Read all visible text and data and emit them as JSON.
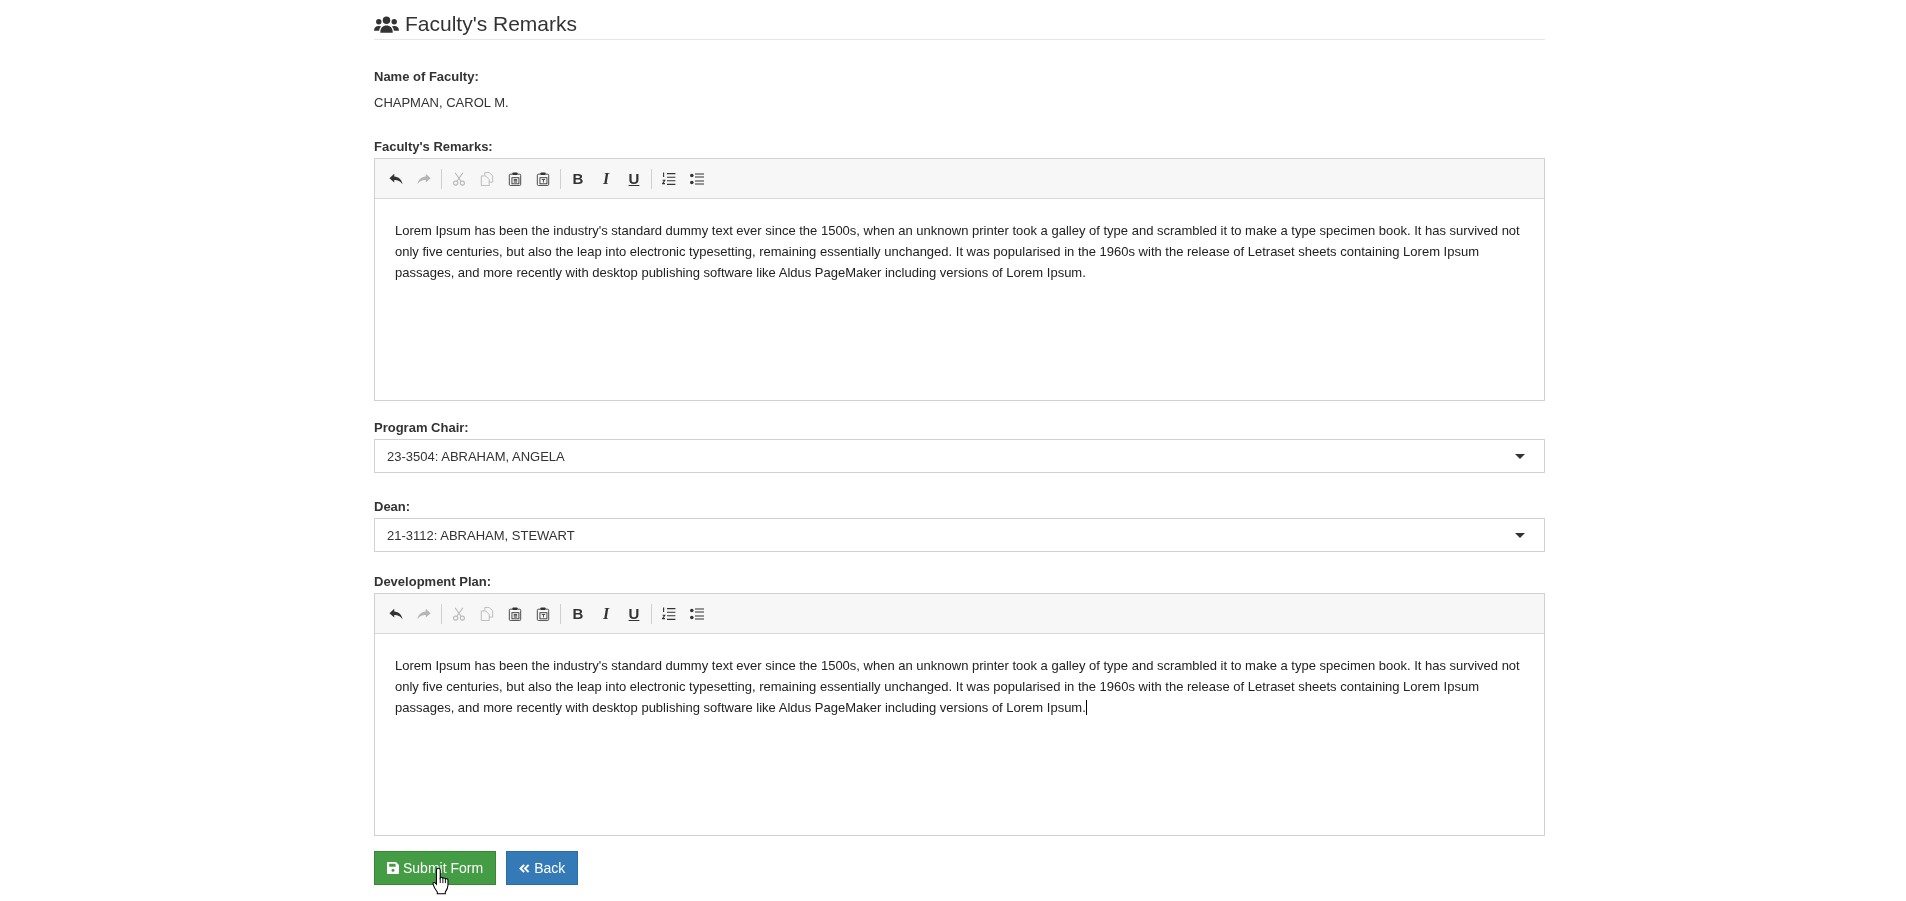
{
  "section": {
    "title": "Faculty's Remarks"
  },
  "faculty": {
    "label": "Name of Faculty:",
    "value": "CHAPMAN, CAROL M."
  },
  "fields": [
    {
      "kind": "editor",
      "label": "Faculty's Remarks:",
      "focused": false,
      "toolbar": [
        [
          {
            "kind": "undo",
            "disabled": false
          },
          {
            "kind": "redo",
            "disabled": true
          }
        ],
        [
          {
            "kind": "cut",
            "disabled": true
          },
          {
            "kind": "copy",
            "disabled": true
          },
          {
            "kind": "paste",
            "disabled": false
          },
          {
            "kind": "paste_text",
            "disabled": false
          }
        ],
        [
          {
            "kind": "bold",
            "label": "B",
            "disabled": false
          },
          {
            "kind": "italic",
            "label": "I",
            "disabled": false
          },
          {
            "kind": "underline",
            "label": "U",
            "disabled": false
          }
        ],
        [
          {
            "kind": "ordered_list",
            "disabled": false
          },
          {
            "kind": "bullet_list",
            "disabled": false
          }
        ]
      ],
      "content": "Lorem Ipsum has been the industry's standard dummy text ever since the 1500s, when an unknown printer took a galley of type and scrambled it to make a type specimen book. It has survived not only five centuries, but also the leap into electronic typesetting, remaining essentially unchanged. It was popularised in the 1960s with the release of Letraset sheets containing Lorem Ipsum passages, and more recently with desktop publishing software like Aldus PageMaker including versions of Lorem Ipsum."
    },
    {
      "kind": "select",
      "label": "Program Chair:",
      "value": "23-3504: ABRAHAM, ANGELA"
    },
    {
      "kind": "select",
      "label": "Dean:",
      "value": "21-3112: ABRAHAM, STEWART"
    },
    {
      "kind": "editor",
      "label": "Development Plan:",
      "focused": true,
      "toolbar": [
        [
          {
            "kind": "undo",
            "disabled": false
          },
          {
            "kind": "redo",
            "disabled": true
          }
        ],
        [
          {
            "kind": "cut",
            "disabled": true
          },
          {
            "kind": "copy",
            "disabled": true
          },
          {
            "kind": "paste",
            "disabled": false
          },
          {
            "kind": "paste_text",
            "disabled": false
          }
        ],
        [
          {
            "kind": "bold",
            "label": "B",
            "disabled": false
          },
          {
            "kind": "italic",
            "label": "I",
            "disabled": false
          },
          {
            "kind": "underline",
            "label": "U",
            "disabled": false
          }
        ],
        [
          {
            "kind": "ordered_list",
            "disabled": false
          },
          {
            "kind": "bullet_list",
            "disabled": false
          }
        ]
      ],
      "content": "Lorem Ipsum has been the industry's standard dummy text ever since the 1500s, when an unknown printer took a galley of type and scrambled it to make a type specimen book. It has survived not only five centuries, but also the leap into electronic typesetting, remaining essentially unchanged. It was popularised in the 1960s with the release of Letraset sheets containing Lorem Ipsum passages, and more recently with desktop publishing software like Aldus PageMaker including versions of Lorem Ipsum."
    }
  ],
  "buttons": [
    {
      "kind": "submit",
      "label": "Submit Form",
      "hovered": true
    },
    {
      "kind": "back",
      "label": "Back",
      "hovered": false
    }
  ]
}
